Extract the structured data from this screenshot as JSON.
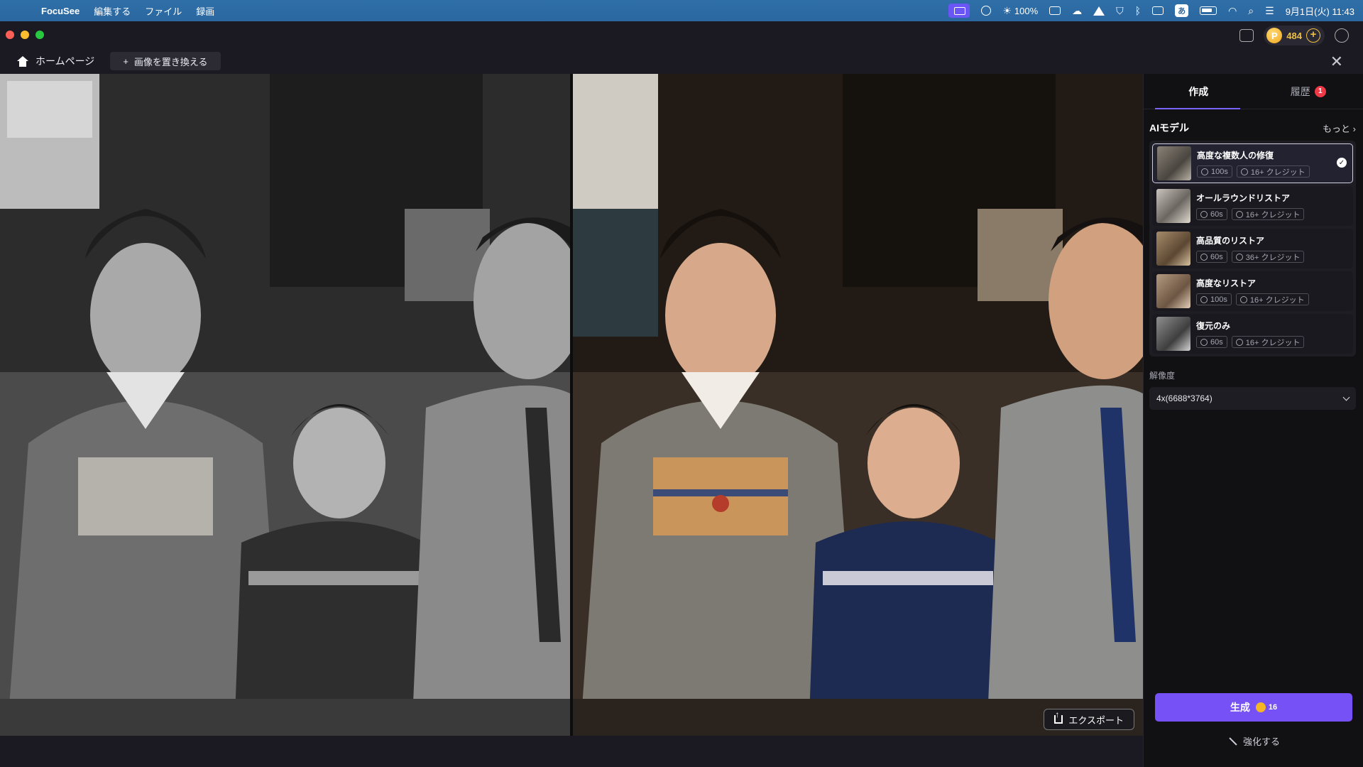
{
  "menubar": {
    "app_name": "FocuSee",
    "menus": [
      "編集する",
      "ファイル",
      "録画"
    ],
    "brightness": "100%",
    "input_method": "あ",
    "datetime": "9月1日(火)  11:43"
  },
  "titlebar": {
    "credits": "484",
    "coin_symbol": "P"
  },
  "toolbar": {
    "home_label": "ホームページ",
    "replace_label": "画像を置き換える",
    "close_symbol": "✕"
  },
  "canvas": {
    "export_label": "エクスポート"
  },
  "panel": {
    "tabs": [
      {
        "label": "作成",
        "active": true
      },
      {
        "label": "履歴",
        "badge": "1"
      }
    ],
    "ai_model_title": "AIモデル",
    "more_label": "もっと",
    "models": [
      {
        "name": "高度な複数人の修復",
        "time": "100s",
        "credits": "16+ クレジット",
        "selected": true
      },
      {
        "name": "オールラウンドリストア",
        "time": "60s",
        "credits": "16+ クレジット"
      },
      {
        "name": "高品質のリストア",
        "time": "60s",
        "credits": "36+ クレジット"
      },
      {
        "name": "高度なリストア",
        "time": "100s",
        "credits": "16+ クレジット"
      },
      {
        "name": "復元のみ",
        "time": "60s",
        "credits": "16+ クレジット"
      }
    ],
    "resolution_label": "解像度",
    "resolution_value": "4x(6688*3764)",
    "generate_label": "生成",
    "generate_cost": "16",
    "enhance_label": "強化する"
  },
  "colors": {
    "accent": "#7652f6",
    "badge": "#ee3a46",
    "coin": "#f0a61a"
  }
}
